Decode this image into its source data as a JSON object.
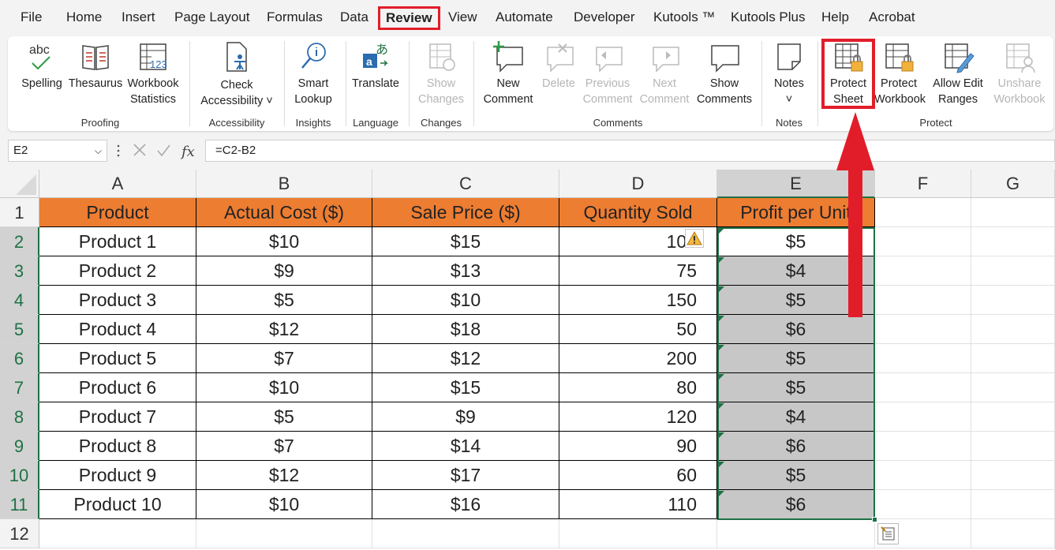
{
  "menu": {
    "items": [
      "File",
      "Home",
      "Insert",
      "Page Layout",
      "Formulas",
      "Data",
      "Review",
      "View",
      "Automate",
      "Developer",
      "Kutools ™",
      "Kutools Plus",
      "Help",
      "Acrobat"
    ],
    "active": "Review"
  },
  "ribbon": {
    "buttons": {
      "spelling_abc": "abc",
      "spelling": "Spelling",
      "thesaurus": "Thesaurus",
      "wb_stats_1": "Workbook",
      "wb_stats_2": "Statistics",
      "wb_stats_num": "123",
      "check_acc_1": "Check",
      "check_acc_2": "Accessibility ˅",
      "smart_1": "Smart",
      "smart_2": "Lookup",
      "translate": "Translate",
      "show_changes_1": "Show",
      "show_changes_2": "Changes",
      "new_comment_1": "New",
      "new_comment_2": "Comment",
      "delete": "Delete",
      "previous_1": "Previous",
      "previous_2": "Comment",
      "next_1": "Next",
      "next_2": "Comment",
      "show_comments_1": "Show",
      "show_comments_2": "Comments",
      "notes": "Notes",
      "notes_dd": "˅",
      "protect_sheet_1": "Protect",
      "protect_sheet_2": "Sheet",
      "protect_wb_1": "Protect",
      "protect_wb_2": "Workbook",
      "allow_edit_1": "Allow Edit",
      "allow_edit_2": "Ranges",
      "unshare_1": "Unshare",
      "unshare_2": "Workbook"
    },
    "groups": {
      "proofing": "Proofing",
      "accessibility": "Accessibility",
      "insights": "Insights",
      "language": "Language",
      "changes": "Changes",
      "comments": "Comments",
      "notes": "Notes",
      "protect": "Protect"
    }
  },
  "formula_bar": {
    "name_box": "E2",
    "formula": "=C2-B2",
    "fx": "fx"
  },
  "sheet": {
    "columns": [
      "A",
      "B",
      "C",
      "D",
      "E",
      "F",
      "G"
    ],
    "selected_column": "E",
    "row_numbers": [
      "1",
      "2",
      "3",
      "4",
      "5",
      "6",
      "7",
      "8",
      "9",
      "10",
      "11",
      "12"
    ],
    "headers": [
      "Product",
      "Actual Cost ($)",
      "Sale Price ($)",
      "Quantity Sold",
      "Profit per Unit"
    ],
    "rows": [
      [
        "Product 1",
        "$10",
        "$15",
        "100",
        "$5"
      ],
      [
        "Product 2",
        "$9",
        "$13",
        "75",
        "$4"
      ],
      [
        "Product 3",
        "$5",
        "$10",
        "150",
        "$5"
      ],
      [
        "Product 4",
        "$12",
        "$18",
        "50",
        "$6"
      ],
      [
        "Product 5",
        "$7",
        "$12",
        "200",
        "$5"
      ],
      [
        "Product 6",
        "$10",
        "$15",
        "80",
        "$5"
      ],
      [
        "Product 7",
        "$5",
        "$9",
        "120",
        "$4"
      ],
      [
        "Product 8",
        "$7",
        "$14",
        "90",
        "$6"
      ],
      [
        "Product 9",
        "$12",
        "$17",
        "60",
        "$5"
      ],
      [
        "Product 10",
        "$10",
        "$16",
        "110",
        "$6"
      ]
    ]
  },
  "colors": {
    "accent_red": "#e21d2a",
    "header_orange": "#ed7d31",
    "excel_green": "#1e7145"
  }
}
